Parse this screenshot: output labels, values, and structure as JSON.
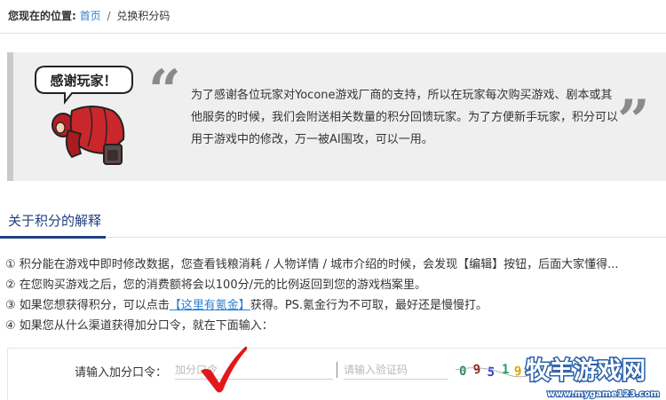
{
  "breadcrumb": {
    "here_label": "您现在的位置:",
    "home": "首页",
    "separator": "/",
    "current": "兑换积分码"
  },
  "intro": {
    "mascot_caption": "感谢玩家！",
    "open_quote": "“",
    "close_quote": "”",
    "text": "为了感谢各位玩家对Yocone游戏厂商的支持，所以在玩家每次购买游戏、剧本或其他服务的时候，我们会附送相关数量的积分回馈玩家。为了方便新手玩家，积分可以用于游戏中的修改，万一被AI围攻，可以一用。"
  },
  "section": {
    "title": "关于积分的解释"
  },
  "points": [
    "① 积分能在游戏中即时修改数据，您查看钱粮消耗 / 人物详情 / 城市介绍的时候，会发现【编辑】按钮，后面大家懂得...",
    "② 在您购买游戏之后，您的消费额将会以100分/元的比例返回到您的游戏档案里。",
    {
      "prefix": "③ 如果您想获得积分，可以点击",
      "link": "【这里有氪金】",
      "suffix": "获得。PS.氪金行为不可取，最好还是慢慢打。"
    },
    "④ 如果您从什么渠道获得加分口令，就在下面输入："
  ],
  "form": {
    "label": "请输入加分口令：",
    "code_placeholder": "加分口令",
    "captcha_placeholder": "请输入验证码",
    "captcha_chars": [
      "0",
      "9",
      "5",
      "1",
      "9",
      "6"
    ],
    "captcha_colors": [
      "#2e8b57",
      "#8b1a1a",
      "#3a3ad6",
      "#1aa05a",
      "#d9a400",
      "#c23b8f"
    ]
  },
  "watermark": {
    "brand": "牧羊游戏网",
    "url": "www.mygame123.com"
  },
  "colors": {
    "link": "#2a7fd4",
    "section_accent": "#1f3f82",
    "quote_bar": "#c9c9c9",
    "check": "#e3171b"
  },
  "icons": {
    "mascot": "bowing-mascot-illustration",
    "check": "red-checkmark-icon"
  }
}
